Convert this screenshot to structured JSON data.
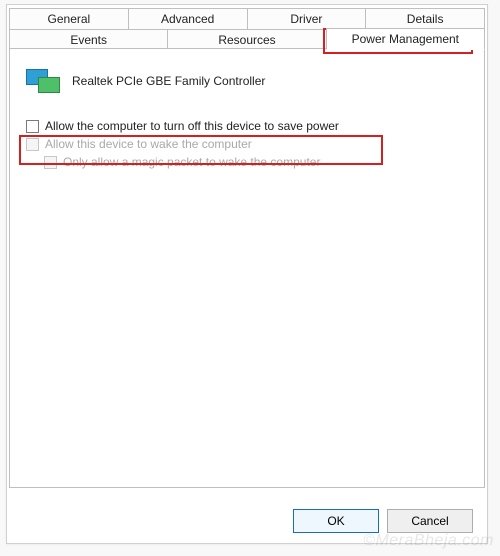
{
  "tabs": {
    "row1": [
      "General",
      "Advanced",
      "Driver",
      "Details"
    ],
    "row2": [
      "Events",
      "Resources",
      "Power Management"
    ],
    "active": "Power Management"
  },
  "device": {
    "name": "Realtek PCIe GBE Family Controller"
  },
  "options": {
    "allow_turn_off": {
      "label": "Allow the computer to turn off this device to save power",
      "checked": false,
      "enabled": true
    },
    "allow_wake": {
      "label": "Allow this device to wake the computer",
      "checked": false,
      "enabled": false
    },
    "magic_packet": {
      "label": "Only allow a magic packet to wake the computer",
      "checked": false,
      "enabled": false
    }
  },
  "buttons": {
    "ok": "OK",
    "cancel": "Cancel"
  },
  "watermark": "©MeraBheja.com"
}
